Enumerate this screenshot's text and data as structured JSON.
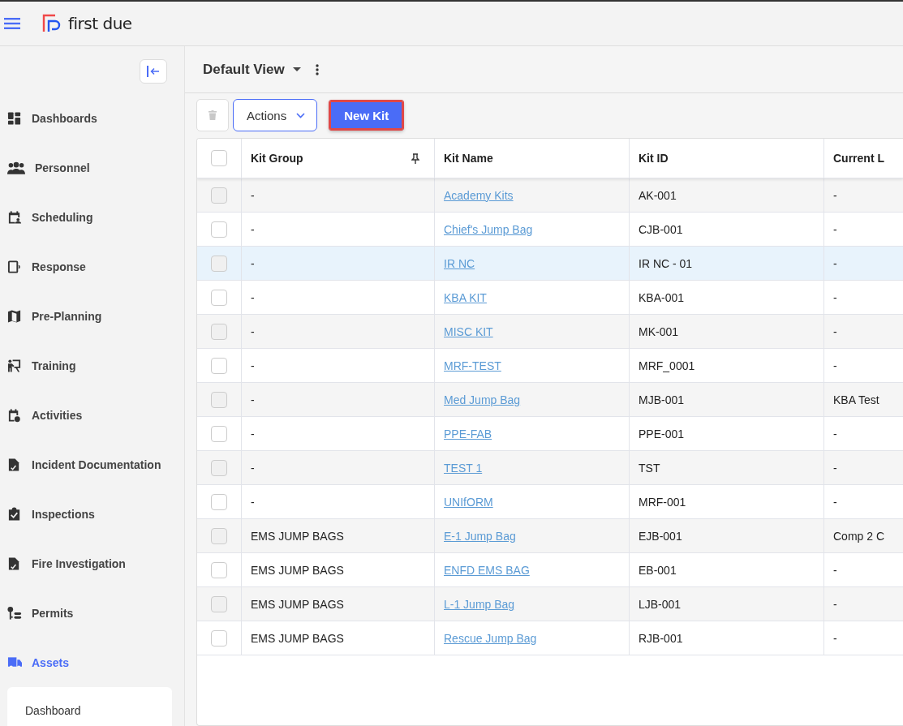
{
  "app": {
    "logo_text": "first due"
  },
  "sidebar": {
    "items": [
      {
        "label": "Dashboards",
        "selected": false
      },
      {
        "label": "Personnel",
        "selected": false
      },
      {
        "label": "Scheduling",
        "selected": false
      },
      {
        "label": "Response",
        "selected": false
      },
      {
        "label": "Pre-Planning",
        "selected": false
      },
      {
        "label": "Training",
        "selected": false
      },
      {
        "label": "Activities",
        "selected": false
      },
      {
        "label": "Incident Documentation",
        "selected": false
      },
      {
        "label": "Inspections",
        "selected": false
      },
      {
        "label": "Fire Investigation",
        "selected": false
      },
      {
        "label": "Permits",
        "selected": false
      },
      {
        "label": "Assets",
        "selected": true
      }
    ],
    "submenu": [
      "Dashboard"
    ]
  },
  "view": {
    "title": "Default View"
  },
  "toolbar": {
    "actions_label": "Actions",
    "new_label": "New Kit"
  },
  "table": {
    "select_all_checked": false,
    "columns": [
      "Kit Group",
      "Kit Name",
      "Kit ID",
      "Current L"
    ],
    "rows": [
      {
        "group": "-",
        "name": "Academy Kits",
        "id": "AK-001",
        "column_4": "-",
        "highlighted": false,
        "checked": false
      },
      {
        "group": "-",
        "name": "Chief's Jump Bag",
        "id": "CJB-001",
        "column_4": "-",
        "highlighted": false,
        "checked": false
      },
      {
        "group": "-",
        "name": "IR NC",
        "id": "IR NC - 01",
        "column_4": "-",
        "highlighted": true,
        "checked": false
      },
      {
        "group": "-",
        "name": "KBA KIT",
        "id": "KBA-001",
        "column_4": "-",
        "highlighted": false,
        "checked": false
      },
      {
        "group": "-",
        "name": "MISC KIT",
        "id": "MK-001",
        "column_4": "-",
        "highlighted": false,
        "checked": false
      },
      {
        "group": "-",
        "name": "MRF-TEST",
        "id": "MRF_0001",
        "column_4": "-",
        "highlighted": false,
        "checked": false
      },
      {
        "group": "-",
        "name": "Med Jump Bag",
        "id": "MJB-001",
        "column_4": "KBA Test",
        "highlighted": false,
        "checked": false
      },
      {
        "group": "-",
        "name": "PPE-FAB",
        "id": "PPE-001",
        "column_4": "-",
        "highlighted": false,
        "checked": false
      },
      {
        "group": "-",
        "name": "TEST 1",
        "id": "TST",
        "column_4": "-",
        "highlighted": false,
        "checked": false
      },
      {
        "group": "-",
        "name": "UNIfORM",
        "id": "MRF-001",
        "column_4": "-",
        "highlighted": false,
        "checked": false
      },
      {
        "group": "EMS JUMP BAGS",
        "name": "E-1 Jump Bag",
        "id": "EJB-001",
        "column_4": "Comp 2 C",
        "highlighted": false,
        "checked": false
      },
      {
        "group": "EMS JUMP BAGS",
        "name": "ENFD EMS BAG",
        "id": "EB-001",
        "column_4": "-",
        "highlighted": false,
        "checked": false
      },
      {
        "group": "EMS JUMP BAGS",
        "name": "L-1 Jump Bag",
        "id": "LJB-001",
        "column_4": "-",
        "highlighted": false,
        "checked": false
      },
      {
        "group": "EMS JUMP BAGS",
        "name": "Rescue Jump Bag",
        "id": "RJB-001",
        "column_4": "-",
        "highlighted": false,
        "checked": false
      }
    ]
  }
}
